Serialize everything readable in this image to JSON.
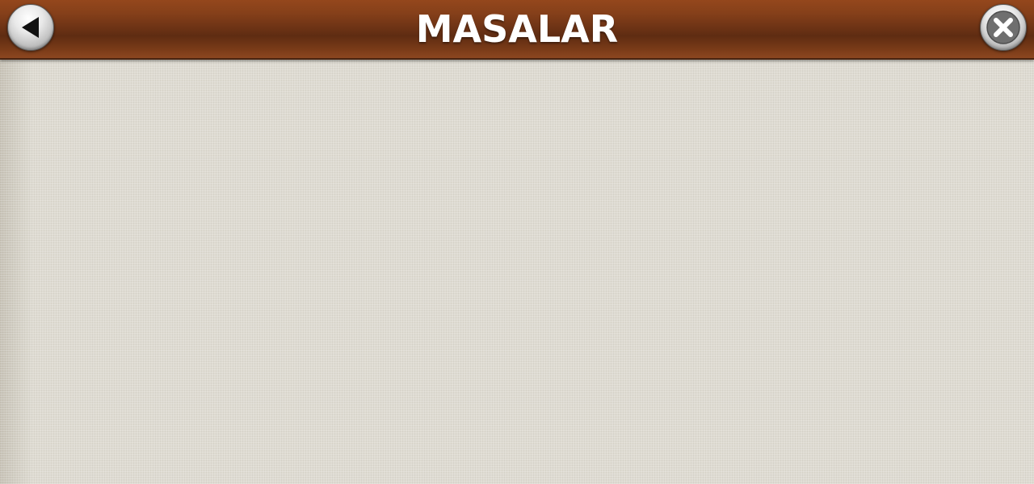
{
  "header": {
    "title": "MASALAR"
  },
  "icons": {
    "back": "back-arrow-icon",
    "close": "close-x-icon"
  },
  "colors": {
    "header_brown": "#6d3315",
    "background": "#dedbd2",
    "title_text": "#ffffff"
  }
}
